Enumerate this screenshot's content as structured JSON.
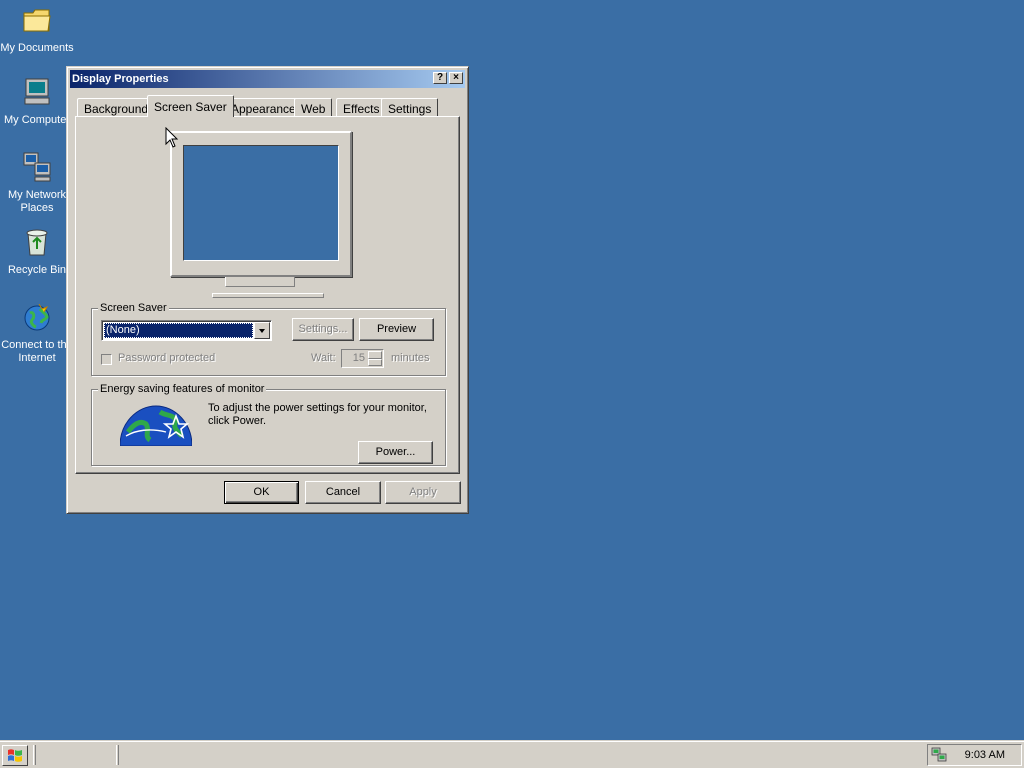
{
  "desktop": {
    "icons": [
      {
        "label": "My Documents"
      },
      {
        "label": "My Computer"
      },
      {
        "label": "My Network Places"
      },
      {
        "label": "Recycle Bin"
      },
      {
        "label": "Connect to the Internet"
      }
    ]
  },
  "window": {
    "title": "Display Properties",
    "help_btn": "?",
    "close_btn": "×",
    "tabs": [
      {
        "label": "Background"
      },
      {
        "label": "Screen Saver",
        "active": true
      },
      {
        "label": "Appearance"
      },
      {
        "label": "Web"
      },
      {
        "label": "Effects"
      },
      {
        "label": "Settings"
      }
    ],
    "screensaver_group": {
      "label": "Screen Saver",
      "selected": "(None)",
      "settings_btn": "Settings...",
      "preview_btn": "Preview",
      "password_label": "Password protected",
      "wait_label": "Wait:",
      "wait_value": "15",
      "minutes_label": "minutes"
    },
    "energy_group": {
      "label": "Energy saving features of monitor",
      "text": "To adjust the power settings for your monitor, click Power.",
      "power_btn": "Power..."
    },
    "buttons": {
      "ok": "OK",
      "cancel": "Cancel",
      "apply": "Apply"
    }
  },
  "taskbar": {
    "clock": "9:03 AM"
  },
  "colors": {
    "desktop": "#3A6EA5",
    "selection": "#0A246A",
    "face": "#D4D0C8"
  }
}
